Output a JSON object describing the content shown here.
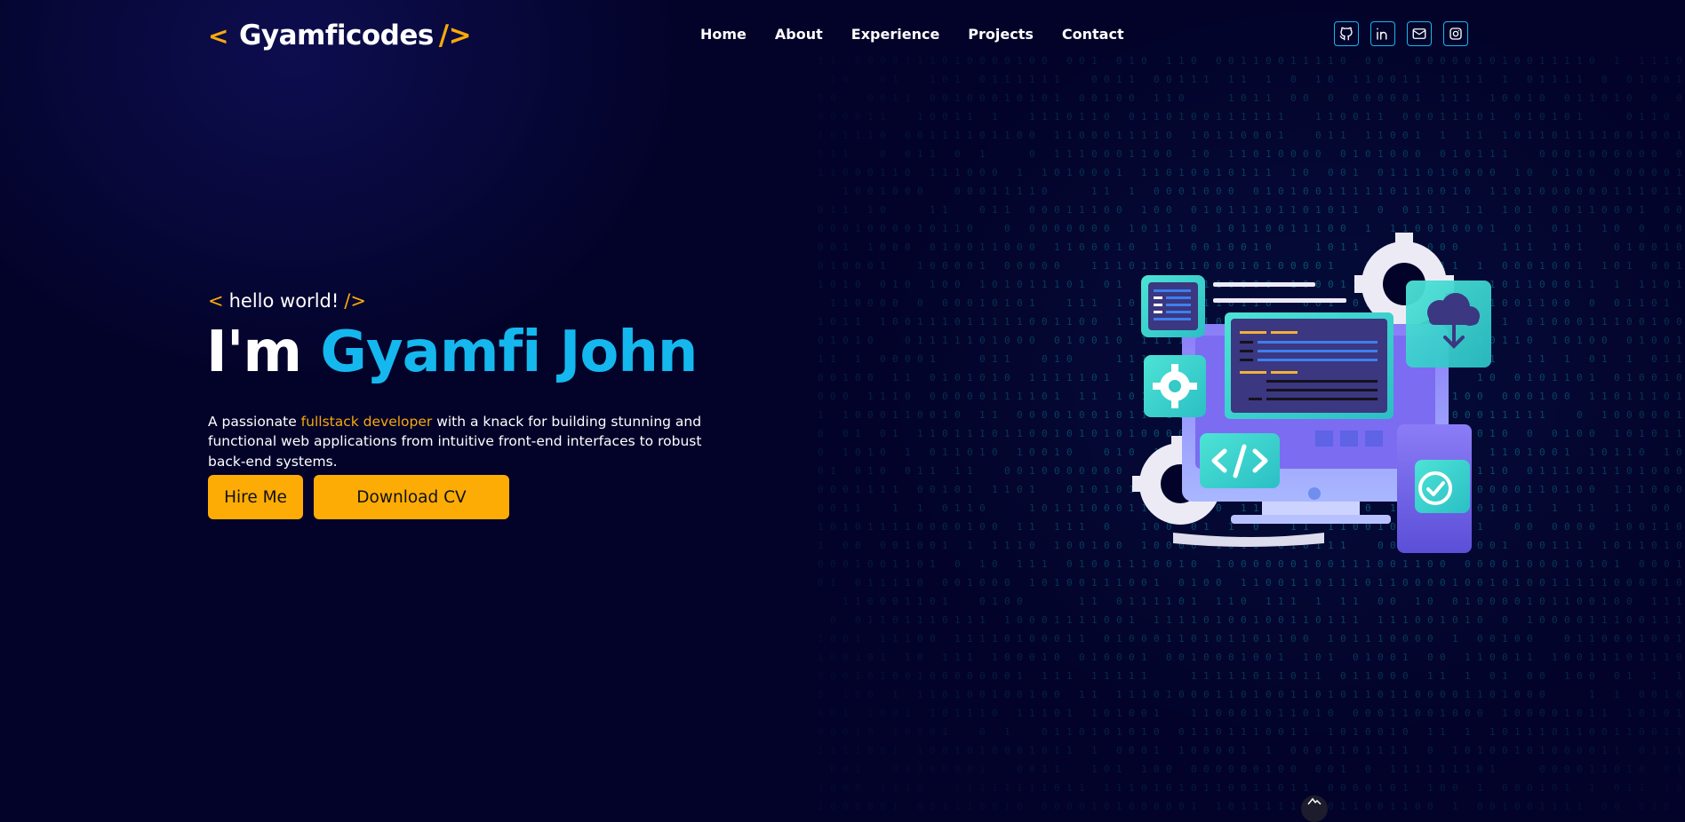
{
  "header": {
    "logo": {
      "open_bracket": "<",
      "text": "Gyamficodes",
      "close_bracket": "/>"
    },
    "nav": [
      "Home",
      "About",
      "Experience",
      "Projects",
      "Contact"
    ],
    "socials": [
      "github-icon",
      "linkedin-icon",
      "mail-icon",
      "instagram-icon"
    ]
  },
  "hero": {
    "greeting": {
      "open": "<",
      "text": "hello world!",
      "close": "/>"
    },
    "title_prefix": "I'm",
    "title_name": "Gyamfi John",
    "description": {
      "before": "A passionate ",
      "highlight": "fullstack developer",
      "after": " with a knack for building stunning and functional web applications from intuitive front-end interfaces to robust back-end systems."
    },
    "buttons": {
      "hire": "Hire Me",
      "download": "Download CV"
    }
  },
  "colors": {
    "background": "#03032a",
    "accent": "#f8a90b",
    "name": "#14b8ee",
    "button": "#fdac06",
    "matrix_text": "#0e6b86"
  }
}
